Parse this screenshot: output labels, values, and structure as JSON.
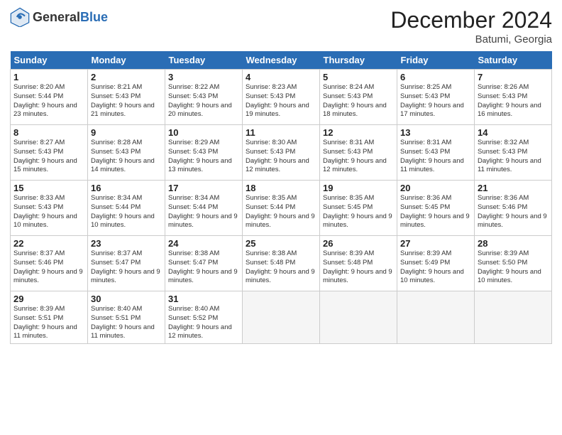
{
  "header": {
    "logo_general": "General",
    "logo_blue": "Blue",
    "month_title": "December 2024",
    "location": "Batumi, Georgia"
  },
  "days_of_week": [
    "Sunday",
    "Monday",
    "Tuesday",
    "Wednesday",
    "Thursday",
    "Friday",
    "Saturday"
  ],
  "weeks": [
    [
      {
        "day": "1",
        "sunrise": "Sunrise: 8:20 AM",
        "sunset": "Sunset: 5:44 PM",
        "daylight": "Daylight: 9 hours and 23 minutes."
      },
      {
        "day": "2",
        "sunrise": "Sunrise: 8:21 AM",
        "sunset": "Sunset: 5:43 PM",
        "daylight": "Daylight: 9 hours and 21 minutes."
      },
      {
        "day": "3",
        "sunrise": "Sunrise: 8:22 AM",
        "sunset": "Sunset: 5:43 PM",
        "daylight": "Daylight: 9 hours and 20 minutes."
      },
      {
        "day": "4",
        "sunrise": "Sunrise: 8:23 AM",
        "sunset": "Sunset: 5:43 PM",
        "daylight": "Daylight: 9 hours and 19 minutes."
      },
      {
        "day": "5",
        "sunrise": "Sunrise: 8:24 AM",
        "sunset": "Sunset: 5:43 PM",
        "daylight": "Daylight: 9 hours and 18 minutes."
      },
      {
        "day": "6",
        "sunrise": "Sunrise: 8:25 AM",
        "sunset": "Sunset: 5:43 PM",
        "daylight": "Daylight: 9 hours and 17 minutes."
      },
      {
        "day": "7",
        "sunrise": "Sunrise: 8:26 AM",
        "sunset": "Sunset: 5:43 PM",
        "daylight": "Daylight: 9 hours and 16 minutes."
      }
    ],
    [
      {
        "day": "8",
        "sunrise": "Sunrise: 8:27 AM",
        "sunset": "Sunset: 5:43 PM",
        "daylight": "Daylight: 9 hours and 15 minutes."
      },
      {
        "day": "9",
        "sunrise": "Sunrise: 8:28 AM",
        "sunset": "Sunset: 5:43 PM",
        "daylight": "Daylight: 9 hours and 14 minutes."
      },
      {
        "day": "10",
        "sunrise": "Sunrise: 8:29 AM",
        "sunset": "Sunset: 5:43 PM",
        "daylight": "Daylight: 9 hours and 13 minutes."
      },
      {
        "day": "11",
        "sunrise": "Sunrise: 8:30 AM",
        "sunset": "Sunset: 5:43 PM",
        "daylight": "Daylight: 9 hours and 12 minutes."
      },
      {
        "day": "12",
        "sunrise": "Sunrise: 8:31 AM",
        "sunset": "Sunset: 5:43 PM",
        "daylight": "Daylight: 9 hours and 12 minutes."
      },
      {
        "day": "13",
        "sunrise": "Sunrise: 8:31 AM",
        "sunset": "Sunset: 5:43 PM",
        "daylight": "Daylight: 9 hours and 11 minutes."
      },
      {
        "day": "14",
        "sunrise": "Sunrise: 8:32 AM",
        "sunset": "Sunset: 5:43 PM",
        "daylight": "Daylight: 9 hours and 11 minutes."
      }
    ],
    [
      {
        "day": "15",
        "sunrise": "Sunrise: 8:33 AM",
        "sunset": "Sunset: 5:43 PM",
        "daylight": "Daylight: 9 hours and 10 minutes."
      },
      {
        "day": "16",
        "sunrise": "Sunrise: 8:34 AM",
        "sunset": "Sunset: 5:44 PM",
        "daylight": "Daylight: 9 hours and 10 minutes."
      },
      {
        "day": "17",
        "sunrise": "Sunrise: 8:34 AM",
        "sunset": "Sunset: 5:44 PM",
        "daylight": "Daylight: 9 hours and 9 minutes."
      },
      {
        "day": "18",
        "sunrise": "Sunrise: 8:35 AM",
        "sunset": "Sunset: 5:44 PM",
        "daylight": "Daylight: 9 hours and 9 minutes."
      },
      {
        "day": "19",
        "sunrise": "Sunrise: 8:35 AM",
        "sunset": "Sunset: 5:45 PM",
        "daylight": "Daylight: 9 hours and 9 minutes."
      },
      {
        "day": "20",
        "sunrise": "Sunrise: 8:36 AM",
        "sunset": "Sunset: 5:45 PM",
        "daylight": "Daylight: 9 hours and 9 minutes."
      },
      {
        "day": "21",
        "sunrise": "Sunrise: 8:36 AM",
        "sunset": "Sunset: 5:46 PM",
        "daylight": "Daylight: 9 hours and 9 minutes."
      }
    ],
    [
      {
        "day": "22",
        "sunrise": "Sunrise: 8:37 AM",
        "sunset": "Sunset: 5:46 PM",
        "daylight": "Daylight: 9 hours and 9 minutes."
      },
      {
        "day": "23",
        "sunrise": "Sunrise: 8:37 AM",
        "sunset": "Sunset: 5:47 PM",
        "daylight": "Daylight: 9 hours and 9 minutes."
      },
      {
        "day": "24",
        "sunrise": "Sunrise: 8:38 AM",
        "sunset": "Sunset: 5:47 PM",
        "daylight": "Daylight: 9 hours and 9 minutes."
      },
      {
        "day": "25",
        "sunrise": "Sunrise: 8:38 AM",
        "sunset": "Sunset: 5:48 PM",
        "daylight": "Daylight: 9 hours and 9 minutes."
      },
      {
        "day": "26",
        "sunrise": "Sunrise: 8:39 AM",
        "sunset": "Sunset: 5:48 PM",
        "daylight": "Daylight: 9 hours and 9 minutes."
      },
      {
        "day": "27",
        "sunrise": "Sunrise: 8:39 AM",
        "sunset": "Sunset: 5:49 PM",
        "daylight": "Daylight: 9 hours and 10 minutes."
      },
      {
        "day": "28",
        "sunrise": "Sunrise: 8:39 AM",
        "sunset": "Sunset: 5:50 PM",
        "daylight": "Daylight: 9 hours and 10 minutes."
      }
    ],
    [
      {
        "day": "29",
        "sunrise": "Sunrise: 8:39 AM",
        "sunset": "Sunset: 5:51 PM",
        "daylight": "Daylight: 9 hours and 11 minutes."
      },
      {
        "day": "30",
        "sunrise": "Sunrise: 8:40 AM",
        "sunset": "Sunset: 5:51 PM",
        "daylight": "Daylight: 9 hours and 11 minutes."
      },
      {
        "day": "31",
        "sunrise": "Sunrise: 8:40 AM",
        "sunset": "Sunset: 5:52 PM",
        "daylight": "Daylight: 9 hours and 12 minutes."
      },
      null,
      null,
      null,
      null
    ]
  ]
}
